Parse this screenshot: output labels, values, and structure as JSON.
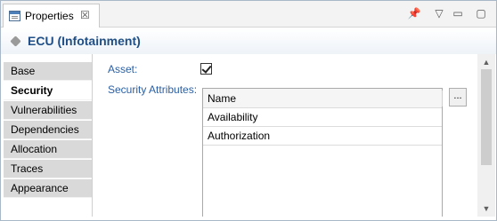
{
  "view": {
    "tab_title": "Properties",
    "close_glyph": "☒",
    "actions": [
      {
        "name": "pin-icon",
        "glyph": "📌"
      },
      {
        "name": "view-menu-icon",
        "glyph": "▽"
      },
      {
        "name": "minimize-icon",
        "glyph": "▭"
      },
      {
        "name": "maximize-icon",
        "glyph": "▢"
      }
    ]
  },
  "header": {
    "title": "ECU (Infotainment)"
  },
  "sidebar": {
    "items": [
      {
        "label": "Base"
      },
      {
        "label": "Security"
      },
      {
        "label": "Vulnerabilities"
      },
      {
        "label": "Dependencies"
      },
      {
        "label": "Allocation"
      },
      {
        "label": "Traces"
      },
      {
        "label": "Appearance"
      }
    ],
    "active": "Security"
  },
  "form": {
    "asset_label": "Asset:",
    "asset_checked": true,
    "security_attributes_label": "Security Attributes:",
    "table": {
      "header": "Name",
      "rows": [
        "Availability",
        "Authorization"
      ]
    },
    "browse_button": "..."
  },
  "colors": {
    "label_blue": "#2b5fa3",
    "title_blue": "#1f4f86",
    "tab_bg": "#d9d9d9"
  }
}
